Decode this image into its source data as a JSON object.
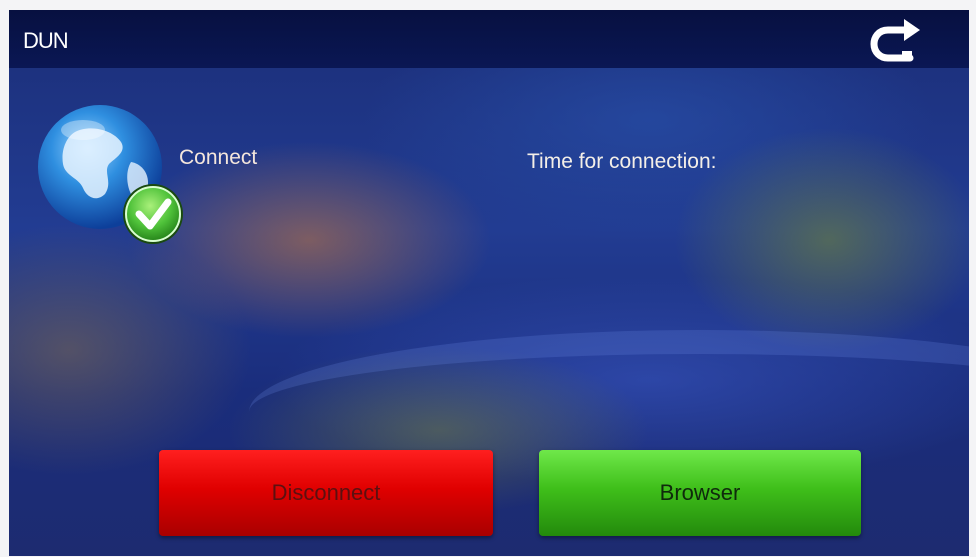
{
  "header": {
    "title": "DUN",
    "back_icon": "return-arrow-icon"
  },
  "status": {
    "icon": "globe-check-icon",
    "text": "Connect",
    "time_label": "Time for connection:"
  },
  "actions": {
    "disconnect_label": "Disconnect",
    "browser_label": "Browser"
  },
  "colors": {
    "header_bg": "#0a1754",
    "background": "#1f378a",
    "disconnect": "#e00000",
    "browser": "#3fbf1a",
    "check": "#4fc23a"
  }
}
